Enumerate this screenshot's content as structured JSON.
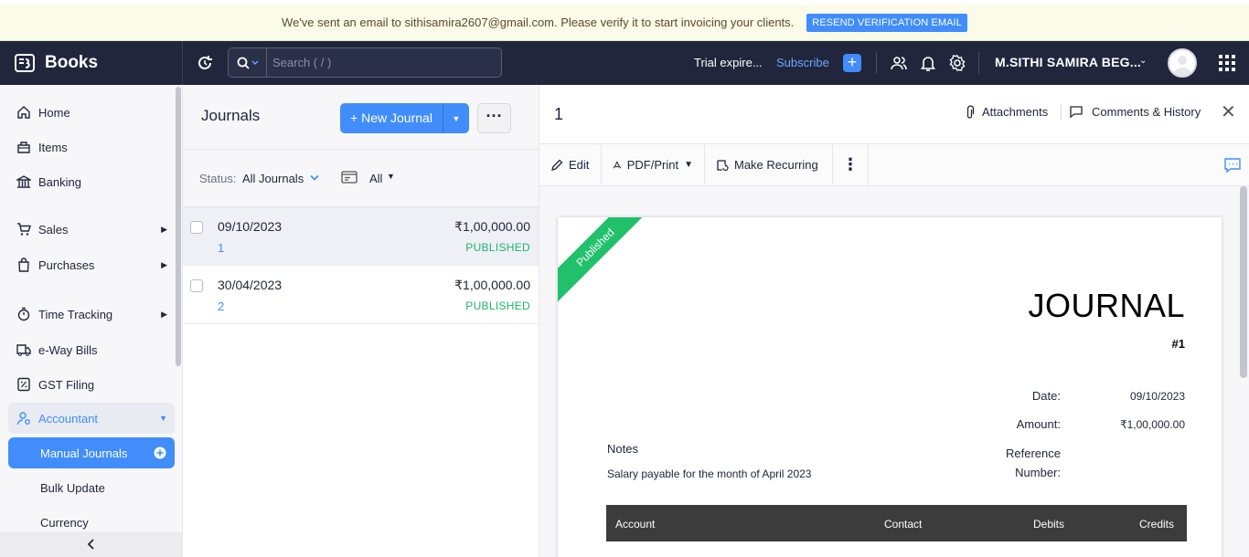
{
  "banner": {
    "message": "We've sent an email to sithisamira2607@gmail.com. Please verify it to start invoicing your clients.",
    "button": "RESEND VERIFICATION EMAIL"
  },
  "topbar": {
    "brand": "Books",
    "search_placeholder": "Search ( / )",
    "trial": "Trial expire...",
    "subscribe": "Subscribe",
    "org_name": "M.SITHI SAMIRA BEG..."
  },
  "sidebar": {
    "items": [
      {
        "label": "Home",
        "icon": "home-icon"
      },
      {
        "label": "Items",
        "icon": "items-icon"
      },
      {
        "label": "Banking",
        "icon": "bank-icon"
      },
      {
        "label": "Sales",
        "icon": "cart-icon"
      },
      {
        "label": "Purchases",
        "icon": "bag-icon"
      },
      {
        "label": "Time Tracking",
        "icon": "stopwatch-icon"
      },
      {
        "label": "e-Way Bills",
        "icon": "truck-icon"
      },
      {
        "label": "GST Filing",
        "icon": "gst-icon"
      },
      {
        "label": "Accountant",
        "icon": "accountant-icon"
      }
    ],
    "sub_items": [
      "Manual Journals",
      "Bulk Update",
      "Currency"
    ]
  },
  "list": {
    "title": "Journals",
    "new_button": "+ New Journal",
    "status_label": "Status:",
    "status_value": "All Journals",
    "period_value": "All",
    "rows": [
      {
        "date": "09/10/2023",
        "number": "1",
        "amount": "₹1,00,000.00",
        "status": "PUBLISHED"
      },
      {
        "date": "30/04/2023",
        "number": "2",
        "amount": "₹1,00,000.00",
        "status": "PUBLISHED"
      }
    ]
  },
  "detail": {
    "title": "1",
    "attachments": "Attachments",
    "comments": "Comments & History",
    "toolbar": {
      "edit": "Edit",
      "pdf": "PDF/Print",
      "recurring": "Make Recurring"
    },
    "document": {
      "ribbon": "Published",
      "heading": "JOURNAL",
      "number": "#1",
      "date_label": "Date:",
      "date_value": "09/10/2023",
      "amount_label": "Amount:",
      "amount_value": "₹1,00,000.00",
      "ref_label_1": "Reference",
      "ref_label_2": "Number:",
      "notes_label": "Notes",
      "notes_value": "Salary payable for the month of April 2023",
      "table_headers": {
        "account": "Account",
        "contact": "Contact",
        "debits": "Debits",
        "credits": "Credits"
      }
    }
  },
  "colors": {
    "accent": "#408dfb",
    "topbar": "#21263c",
    "published": "#1fb36b",
    "ribbon": "#21c16b"
  }
}
